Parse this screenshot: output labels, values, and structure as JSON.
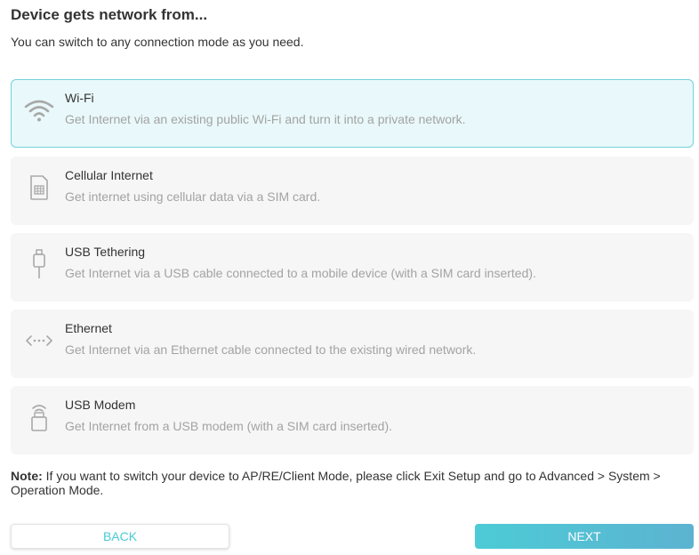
{
  "header": {
    "title": "Device gets network from...",
    "subtitle": "You can switch to any connection mode as you need."
  },
  "options": [
    {
      "title": "Wi-Fi",
      "desc": "Get Internet via an existing public Wi-Fi and turn it into a private network.",
      "icon": "wifi-icon",
      "selected": true
    },
    {
      "title": "Cellular Internet",
      "desc": "Get internet using cellular data via a SIM card.",
      "icon": "sim-card-icon",
      "selected": false
    },
    {
      "title": "USB Tethering",
      "desc": "Get Internet via a USB cable connected to a mobile device (with a SIM card inserted).",
      "icon": "usb-cable-icon",
      "selected": false
    },
    {
      "title": "Ethernet",
      "desc": "Get Internet via an Ethernet cable connected to the existing wired network.",
      "icon": "ethernet-icon",
      "selected": false
    },
    {
      "title": "USB Modem",
      "desc": "Get Internet from a USB modem (with a SIM card inserted).",
      "icon": "usb-modem-icon",
      "selected": false
    }
  ],
  "note": {
    "label": "Note:",
    "text": " If you want to switch your device to AP/RE/Client Mode, please click Exit Setup and go to Advanced > System > Operation Mode."
  },
  "buttons": {
    "back": "BACK",
    "next": "NEXT"
  },
  "colors": {
    "accent": "#4acbd6",
    "selected_bg": "#e9f8fa",
    "selected_border": "#6fd3dc",
    "card_bg": "#f6f6f6",
    "desc_text": "#a3a3a3"
  }
}
